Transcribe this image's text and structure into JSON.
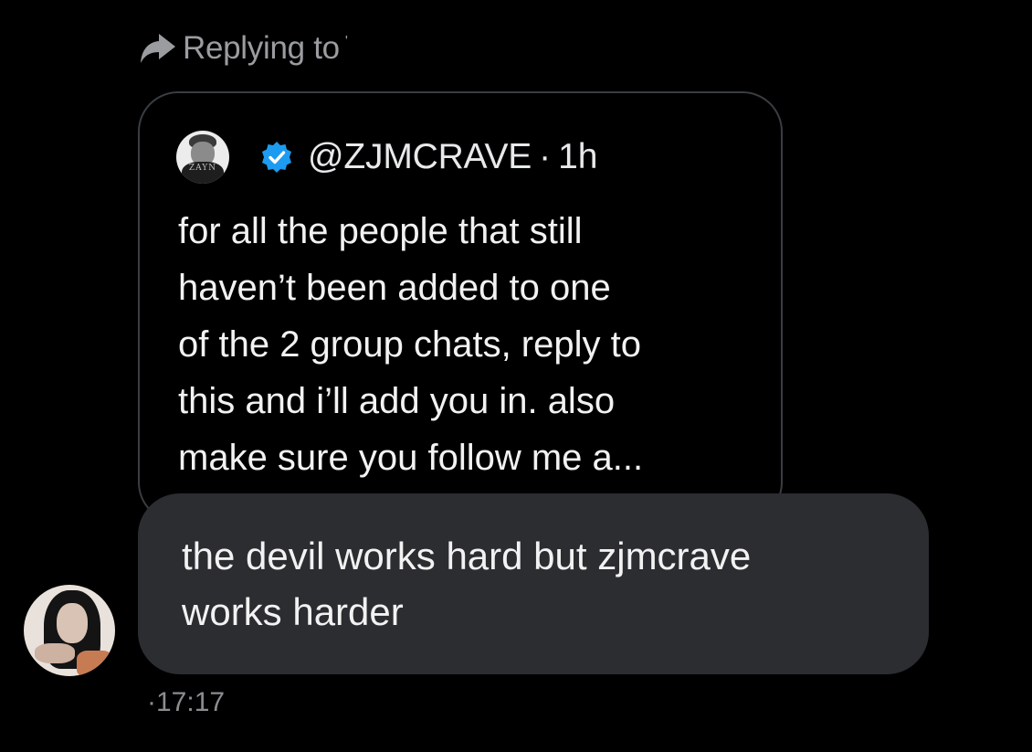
{
  "reply_header": {
    "label": "Replying to",
    "handle_mark": "'",
    "icon": "reply-arrow-icon"
  },
  "quoted_tweet": {
    "avatar_text": "ZAYN",
    "verified_icon": "verified-badge-icon",
    "verified_color": "#1d9bf0",
    "handle": "@ZJMCRAVE",
    "separator": "·",
    "time": "1h",
    "text": "for all the people that still\nhaven’t been added to one\nof the 2 group chats, reply to\nthis and i’ll add you in. also\nmake sure you follow me a..."
  },
  "reply": {
    "text": "the devil works hard but zjmcrave\nworks harder",
    "bubble_color": "#2b2d31"
  },
  "timestamp": "·17:17"
}
